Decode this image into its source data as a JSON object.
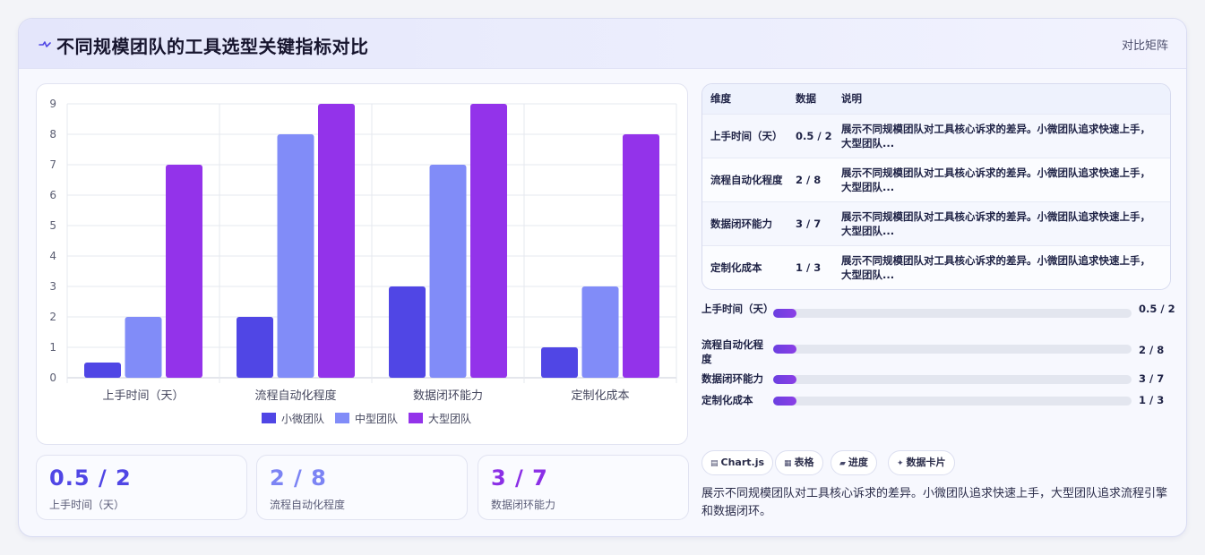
{
  "header": {
    "title": "不同规模团队的工具选型关键指标对比",
    "tag": "对比矩阵"
  },
  "colors": {
    "small": "#5046e5",
    "medium": "#818cf8",
    "large": "#9333ea",
    "stat_small": "#5046e5",
    "stat_medium": "#7c84f4",
    "stat_large": "#8b2fe6"
  },
  "chart_data": {
    "type": "bar",
    "categories": [
      "上手时间（天）",
      "流程自动化程度",
      "数据闭环能力",
      "定制化成本"
    ],
    "series": [
      {
        "name": "小微团队",
        "values": [
          0.5,
          2,
          3,
          1
        ]
      },
      {
        "name": "中型团队",
        "values": [
          2,
          8,
          7,
          3
        ]
      },
      {
        "name": "大型团队",
        "values": [
          7,
          9,
          9,
          8
        ]
      }
    ],
    "ylim": [
      0,
      9
    ],
    "yticks": [
      "0",
      "1",
      "2",
      "3",
      "4",
      "5",
      "6",
      "7",
      "8",
      "9"
    ],
    "grid": true,
    "legend_position": "bottom"
  },
  "stats": [
    {
      "value": "0.5 / 2",
      "label": "上手时间（天）"
    },
    {
      "value": "2 / 8",
      "label": "流程自动化程度"
    },
    {
      "value": "3 / 7",
      "label": "数据闭环能力"
    }
  ],
  "table": {
    "headers": [
      "维度",
      "数据",
      "说明"
    ],
    "rows": [
      {
        "dim": "上手时间（天）",
        "data": "0.5 / 2",
        "note": "展示不同规模团队对工具核心诉求的差异。小微团队追求快速上手，大型团队..."
      },
      {
        "dim": "流程自动化程度",
        "data": "2 / 8",
        "note": "展示不同规模团队对工具核心诉求的差异。小微团队追求快速上手，大型团队..."
      },
      {
        "dim": "数据闭环能力",
        "data": "3 / 7",
        "note": "展示不同规模团队对工具核心诉求的差异。小微团队追求快速上手，大型团队..."
      },
      {
        "dim": "定制化成本",
        "data": "1 / 3",
        "note": "展示不同规模团队对工具核心诉求的差异。小微团队追求快速上手，大型团队..."
      }
    ]
  },
  "progress": [
    {
      "label": "上手时间（天）",
      "value": "0.5 / 2",
      "fill": 0.065
    },
    {
      "label": "流程自动化程度",
      "value": "2 / 8",
      "fill": 0.065
    },
    {
      "label": "数据闭环能力",
      "value": "3 / 7",
      "fill": 0.065
    },
    {
      "label": "定制化成本",
      "value": "1 / 3",
      "fill": 0.065
    }
  ],
  "chips": [
    {
      "icon": "table-icon",
      "glyph": "▤",
      "label": "Chart.js"
    },
    {
      "icon": "grid-icon",
      "glyph": "▦",
      "label": "表格"
    },
    {
      "icon": "progress-icon",
      "glyph": "▰",
      "label": "进度"
    },
    {
      "icon": "sparkle-icon",
      "glyph": "✦",
      "label": "数据卡片"
    }
  ],
  "description": "展示不同规模团队对工具核心诉求的差异。小微团队追求快速上手，大型团队追求流程引擎和数据闭环。"
}
